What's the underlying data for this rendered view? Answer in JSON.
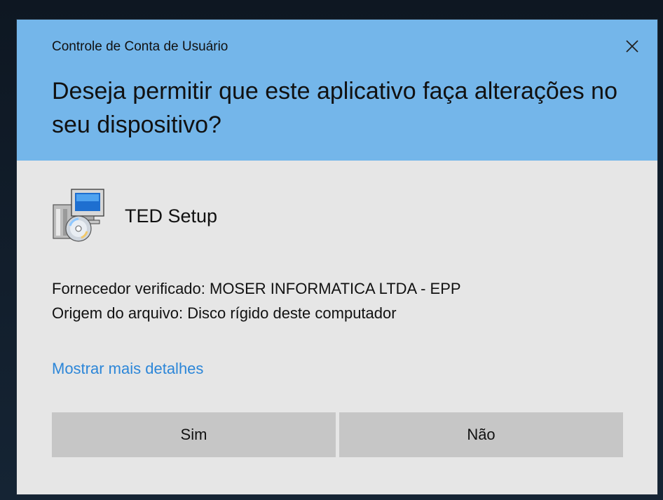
{
  "dialog": {
    "caption": "Controle de Conta de Usuário",
    "question": "Deseja permitir que este aplicativo faça alterações no seu dispositivo?",
    "close_icon": "close-icon",
    "colors": {
      "header": "#74b6ea",
      "body": "#e6e6e6",
      "button": "#c6c6c6",
      "link": "#2c86d8"
    }
  },
  "app": {
    "icon": "installer-icon",
    "name": "TED Setup"
  },
  "details": {
    "publisher_line": "Fornecedor verificado: MOSER INFORMATICA LTDA - EPP",
    "origin_line": "Origem do arquivo: Disco rígido deste computador",
    "more_details_label": "Mostrar mais detalhes"
  },
  "buttons": {
    "yes_label": "Sim",
    "no_label": "Não"
  }
}
